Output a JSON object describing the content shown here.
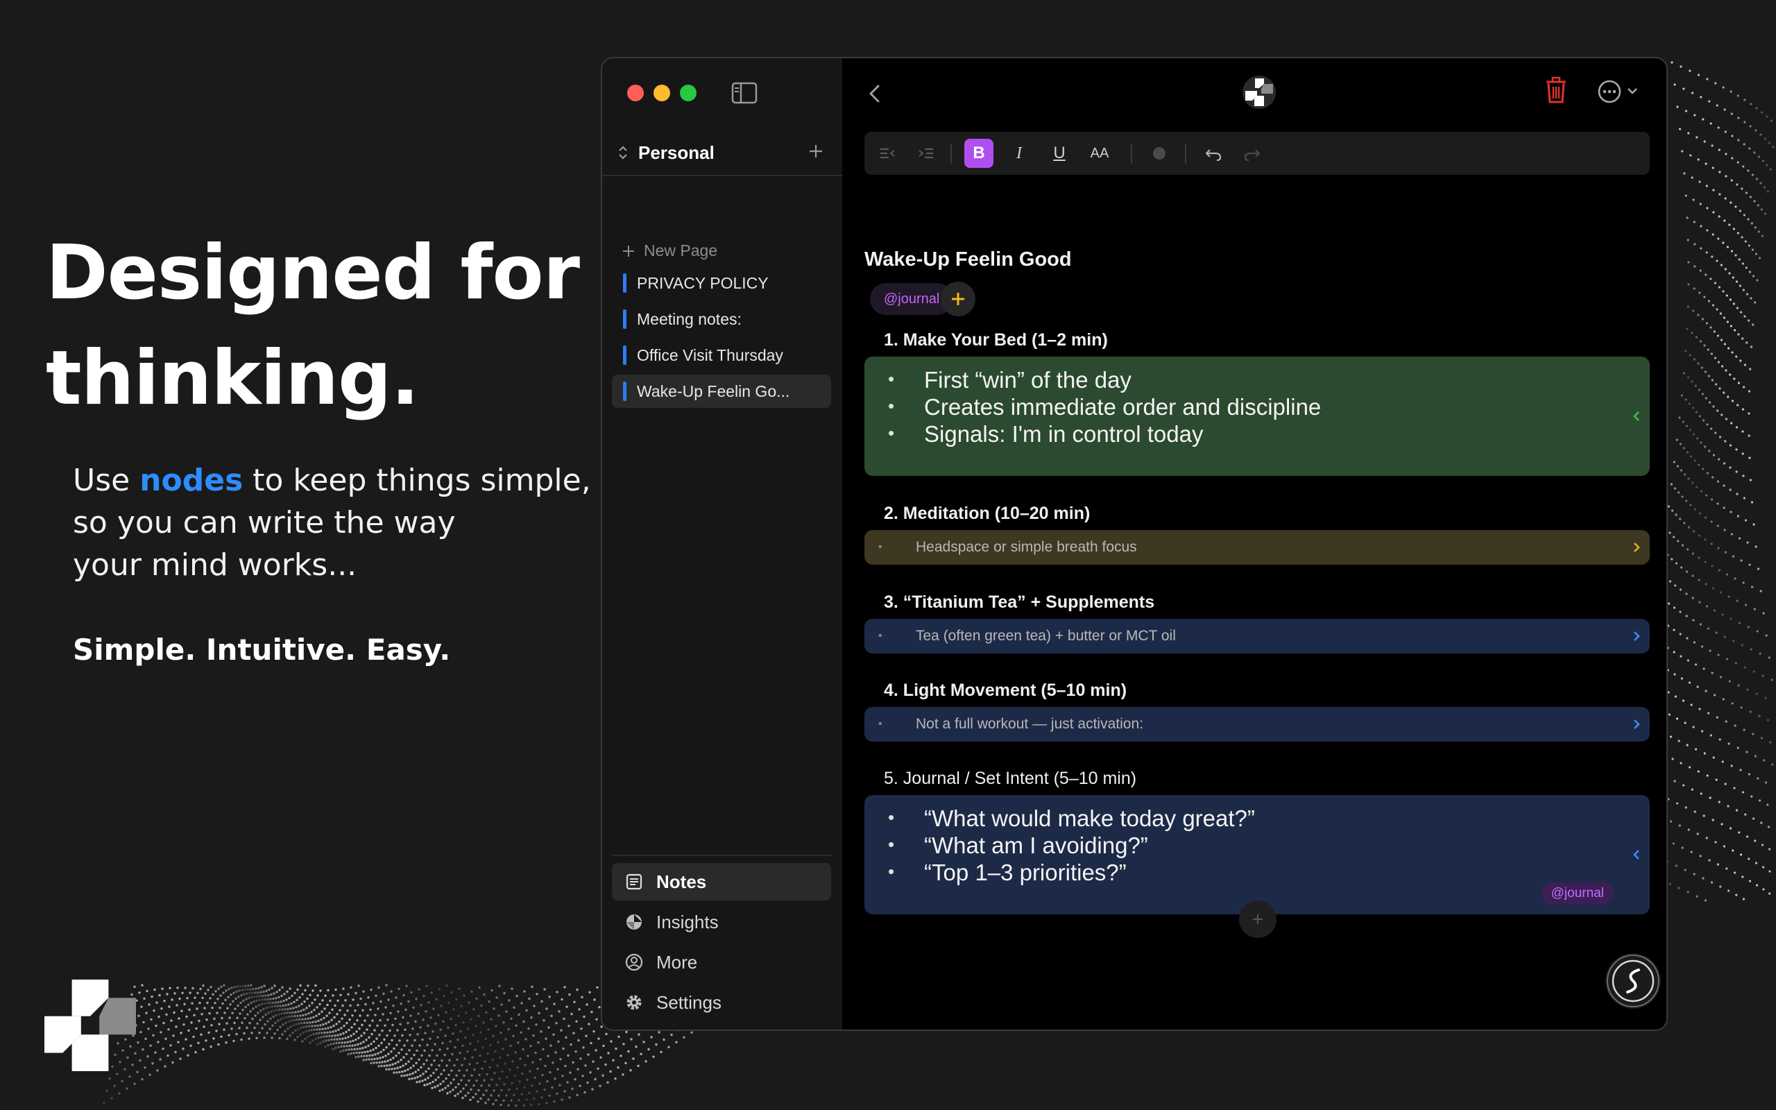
{
  "marketing": {
    "headline_line1": "Designed for",
    "headline_line2": "thinking.",
    "subcopy_pre": "Use ",
    "subcopy_accent": "nodes",
    "subcopy_post1": " to keep things simple,",
    "subcopy_line2": "so you can write the way",
    "subcopy_line3": "your mind works...",
    "tagline": "Simple. Intuitive. Easy.",
    "accent_color": "#2f8cff"
  },
  "sidebar": {
    "workspace": "Personal",
    "new_page_label": "New Page",
    "pages": [
      {
        "label": "PRIVACY POLICY"
      },
      {
        "label": "Meeting notes:"
      },
      {
        "label": "Office Visit Thursday"
      },
      {
        "label": "Wake-Up Feelin Go..."
      }
    ],
    "active_page": "Wake-Up Feelin Go...",
    "page_marker_color": "#2d7cf6",
    "nav": [
      {
        "label": "Notes",
        "icon": "notes-icon"
      },
      {
        "label": "Insights",
        "icon": "insights-icon"
      },
      {
        "label": "More",
        "icon": "user-circle-icon"
      },
      {
        "label": "Settings",
        "icon": "gear-icon"
      }
    ],
    "active_nav": "Notes"
  },
  "toolbar": {
    "bold_label": "B",
    "italic_label": "I",
    "underline_label": "U",
    "text_size_label": "AA",
    "bold_active_color": "#b14ef0"
  },
  "document": {
    "title": "Wake-Up Feelin Good",
    "tag": "@journal",
    "sections": [
      {
        "title": "1. Make Your Bed (1–2 min)",
        "card_color": "#2c4a2f",
        "expanded": true,
        "items": [
          "First “win” of the day",
          "Creates immediate order and discipline",
          "Signals: I'm in control today"
        ]
      },
      {
        "title": "2. Meditation (10–20 min)",
        "card_color": "#3e3721",
        "expanded": false,
        "summary": "Headspace or simple breath focus"
      },
      {
        "title": "3. “Titanium Tea” + Supplements",
        "card_color": "#1d2a47",
        "expanded": false,
        "summary": "Tea (often green tea) + butter or MCT oil"
      },
      {
        "title": "4. Light Movement (5–10 min)",
        "card_color": "#1d2a47",
        "expanded": false,
        "summary": "Not a full workout — just activation:"
      },
      {
        "title": "5. Journal / Set Intent (5–10 min)",
        "card_color": "#1d2a47",
        "expanded": true,
        "items": [
          "“What would make today great?”",
          "“What am I avoiding?”",
          "“Top 1–3 priorities?”"
        ],
        "tag": "@journal"
      }
    ]
  }
}
